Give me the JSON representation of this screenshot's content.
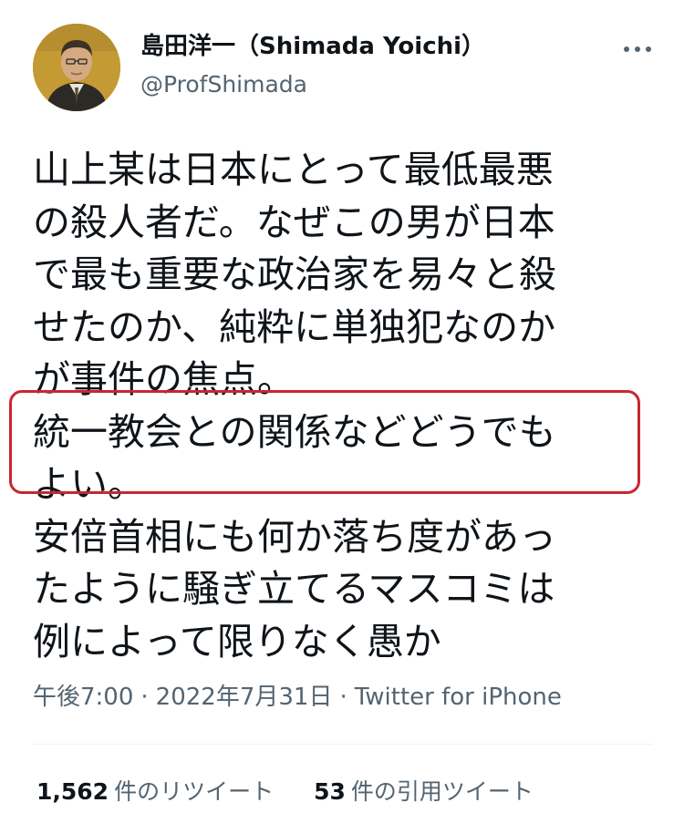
{
  "user": {
    "display_name": "島田洋一（Shimada Yoichi）",
    "handle": "@ProfShimada"
  },
  "header": {
    "more_icon": "more-horizontal-icon"
  },
  "tweet": {
    "lines": [
      "山上某は日本にとって最低最悪",
      "の殺人者だ。なぜこの男が日本",
      "で最も重要な政治家を易々と殺",
      "せたのか、純粋に単独犯なのか",
      "が事件の焦点。",
      "統一教会との関係などどうでも",
      "よい。",
      "安倍首相にも何か落ち度があっ",
      "たように騒ぎ立てるマスコミは",
      "例によって限りなく愚か"
    ],
    "highlight_color": "#c8272f"
  },
  "meta": {
    "time": "午後7:00",
    "separator": "·",
    "date": "2022年7月31日",
    "source": "Twitter for iPhone"
  },
  "stats": {
    "retweets_count": "1,562",
    "retweets_label": "件のリツイート",
    "quotes_count": "53",
    "quotes_label": "件の引用ツイート"
  },
  "colors": {
    "text": "#0f1419",
    "secondary": "#536471",
    "divider": "#eff3f4"
  }
}
